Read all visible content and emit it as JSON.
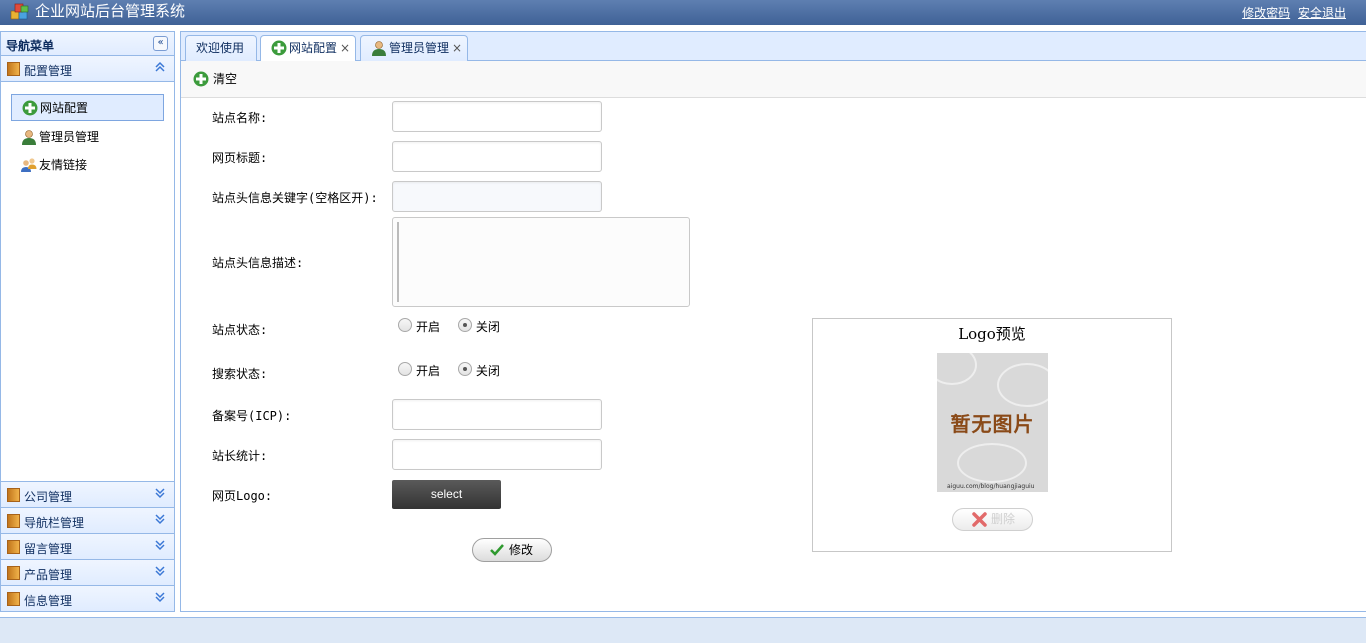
{
  "header": {
    "title": "企业网站后台管理系统",
    "change_password": "修改密码",
    "logout": "安全退出"
  },
  "nav": {
    "title": "导航菜单",
    "collapse_glyph": "«",
    "open_group": {
      "label": "配置管理",
      "items": [
        {
          "label": "网站配置",
          "icon": "add-icon",
          "active": true
        },
        {
          "label": "管理员管理",
          "icon": "user-icon",
          "active": false
        },
        {
          "label": "友情链接",
          "icon": "users-icon",
          "active": false
        }
      ]
    },
    "groups": [
      "公司管理",
      "导航栏管理",
      "留言管理",
      "产品管理",
      "信息管理"
    ]
  },
  "tabs": [
    {
      "label": "欢迎使用",
      "closable": false,
      "active": false
    },
    {
      "label": "网站配置",
      "closable": true,
      "active": true
    },
    {
      "label": "管理员管理",
      "closable": true,
      "active": false
    }
  ],
  "tab_close_glyph": "×",
  "toolbar": {
    "clear_label": "清空"
  },
  "form": {
    "site_name": {
      "label": "站点名称:",
      "value": ""
    },
    "page_title": {
      "label": "网页标题:",
      "value": ""
    },
    "keywords": {
      "label": "站点头信息关键字(空格区开):",
      "value": ""
    },
    "description": {
      "label": "站点头信息描述:",
      "value": ""
    },
    "site_status": {
      "label": "站点状态:",
      "options": [
        "开启",
        "关闭"
      ],
      "selected": "关闭"
    },
    "search_status": {
      "label": "搜索状态:",
      "options": [
        "开启",
        "关闭"
      ],
      "selected": "关闭"
    },
    "icp": {
      "label": "备案号(ICP):",
      "value": ""
    },
    "stats": {
      "label": "站长统计:",
      "value": ""
    },
    "logo": {
      "label": "网页Logo:",
      "select_label": "select"
    },
    "submit_label": "修改"
  },
  "logo_preview": {
    "title": "Logo预览",
    "placeholder_text": "暂无图片",
    "placeholder_footer": "aiguu.com/blog/huangjiaguiu",
    "delete_label": "删除"
  },
  "colors": {
    "header_bg": "#4a6ca3",
    "panel_border": "#95b8e7",
    "accent": "#3b78d6"
  }
}
